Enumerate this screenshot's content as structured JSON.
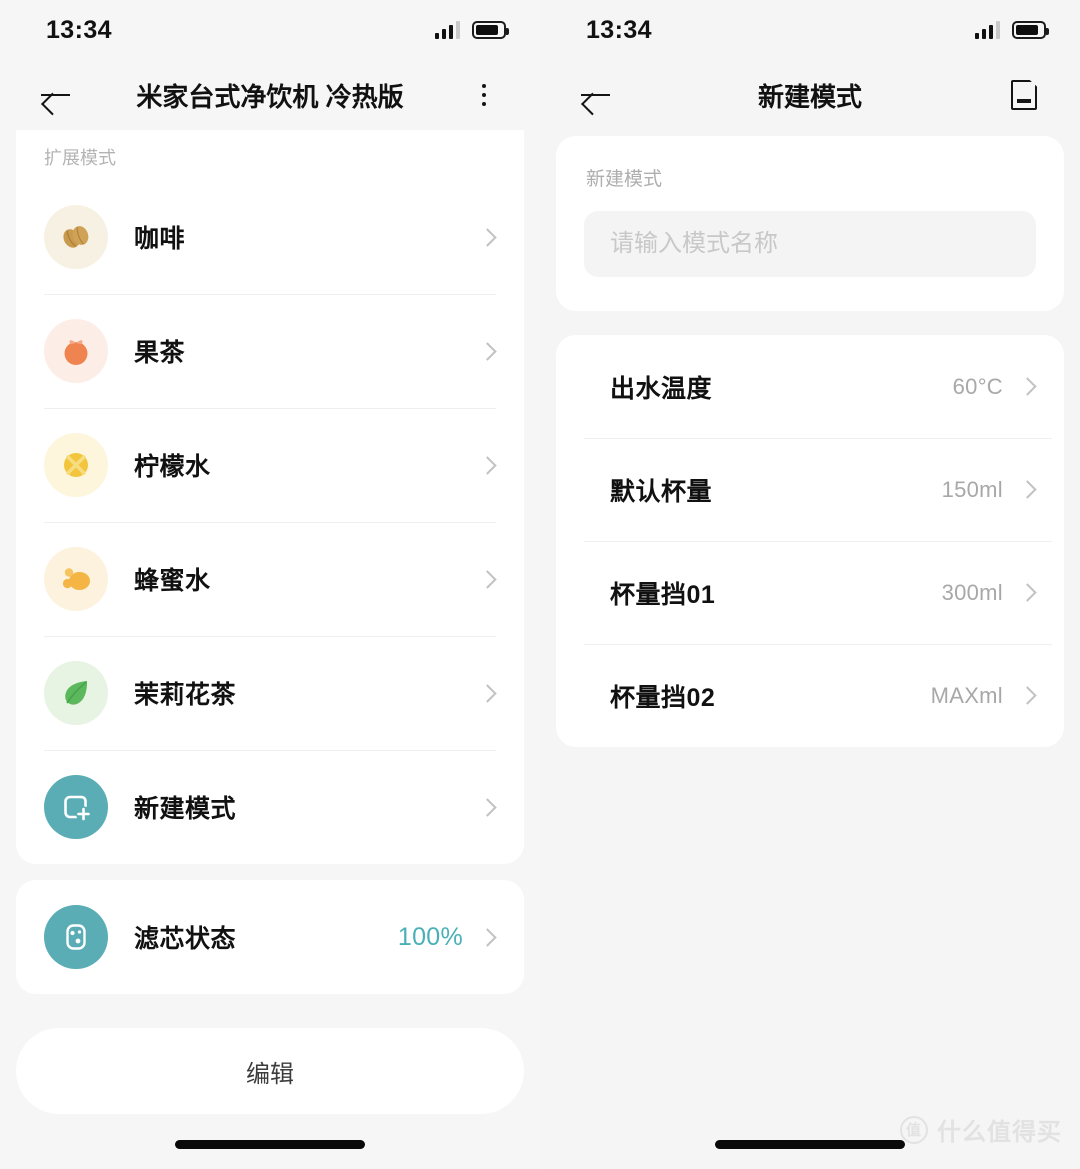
{
  "left": {
    "status": {
      "time": "13:34",
      "battery_level": "85",
      "signal_bars": "3"
    },
    "nav": {
      "title": "米家台式净饮机 冷热版",
      "back_icon": "back-arrow-icon",
      "menu_icon": "more-vertical-icon"
    },
    "section_label": "扩展模式",
    "modes": [
      {
        "label": "咖啡",
        "icon": "coffee-bean-icon",
        "bg": "#f6f0e1",
        "fg": "#c99a4e"
      },
      {
        "label": "果茶",
        "icon": "orange-fruit-icon",
        "bg": "#fcece4",
        "fg": "#ef8450"
      },
      {
        "label": "柠檬水",
        "icon": "lemon-slice-icon",
        "bg": "#fdf3d6",
        "fg": "#f2c githubs"
      },
      {
        "label": "蜂蜜水",
        "icon": "honey-dipper-icon",
        "bg": "#fdf0d9",
        "fg": "#f5b544"
      },
      {
        "label": "茉莉花茶",
        "icon": "tea-leaf-icon",
        "bg": "#e7f4e2",
        "fg": "#5cb85c"
      },
      {
        "label": "新建模式",
        "icon": "add-mode-icon",
        "bg": "#5aadb5",
        "fg": "#ffffff"
      }
    ],
    "filter": {
      "label": "滤芯状态",
      "value": "100%",
      "icon": "filter-cartridge-icon",
      "bg": "#5aadb5"
    },
    "edit_button": "编辑"
  },
  "right": {
    "status": {
      "time": "13:34",
      "battery_level": "85",
      "signal_bars": "3"
    },
    "nav": {
      "title": "新建模式",
      "back_icon": "back-arrow-icon",
      "save_icon": "save-document-icon"
    },
    "form": {
      "label": "新建模式",
      "placeholder": "请输入模式名称",
      "value": ""
    },
    "settings": [
      {
        "label": "出水温度",
        "value": "60°C"
      },
      {
        "label": "默认杯量",
        "value": "150ml"
      },
      {
        "label": "杯量挡01",
        "value": "300ml"
      },
      {
        "label": "杯量挡02",
        "value": "MAXml"
      }
    ]
  },
  "watermark": {
    "badge": "值",
    "text": "什么值得买"
  },
  "colors": {
    "accent": "#4ab0b8",
    "teal": "#5aadb5",
    "page_bg": "#f6f6f6",
    "card_bg": "#ffffff"
  }
}
